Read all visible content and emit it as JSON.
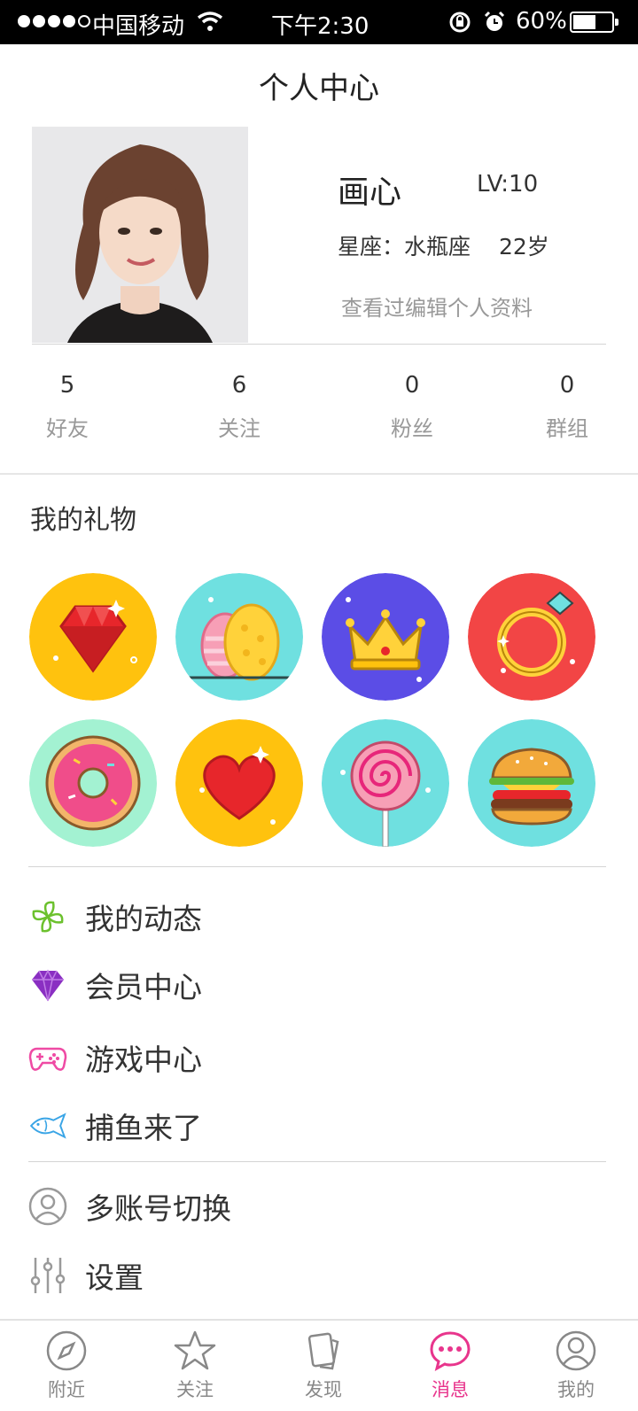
{
  "status_bar": {
    "carrier": "中国移动",
    "time": "下午2:30",
    "battery_text": "60%",
    "battery_level": 0.6,
    "signal_bars": 4,
    "signal_max": 5
  },
  "header": {
    "title": "个人中心"
  },
  "profile": {
    "nickname": "画心",
    "level": "LV:10",
    "zodiac": "星座：水瓶座",
    "age": "22岁",
    "edit_link": "查看过编辑个人资料"
  },
  "stats": [
    {
      "value": "5",
      "label": "好友"
    },
    {
      "value": "6",
      "label": "关注"
    },
    {
      "value": "0",
      "label": "粉丝"
    },
    {
      "value": "0",
      "label": "群组"
    }
  ],
  "gifts": {
    "title": "我的礼物",
    "items": [
      {
        "icon": "ruby-gem-icon",
        "bg": "#ffc20e"
      },
      {
        "icon": "easter-eggs-icon",
        "bg": "#6fe0e0"
      },
      {
        "icon": "crown-icon",
        "bg": "#5b4de6"
      },
      {
        "icon": "diamond-ring-icon",
        "bg": "#f24545"
      },
      {
        "icon": "donut-icon",
        "bg": "#a3f2d2"
      },
      {
        "icon": "heart-icon",
        "bg": "#ffc20e"
      },
      {
        "icon": "lollipop-icon",
        "bg": "#6fe0e0"
      },
      {
        "icon": "burger-icon",
        "bg": "#6fe0e0"
      }
    ]
  },
  "menu": [
    {
      "label": "我的动态",
      "icon": "pinwheel-icon",
      "color": "#6cc12e"
    },
    {
      "label": "会员中心",
      "icon": "diamond-icon",
      "color": "#8a2fc2"
    },
    {
      "label": "游戏中心",
      "icon": "gamepad-icon",
      "color": "#ef4aa4"
    },
    {
      "label": "捕鱼来了",
      "icon": "fish-icon",
      "color": "#3aa5e6"
    },
    {
      "label": "多账号切换",
      "icon": "user-switch-icon",
      "color": "#9a9a9a"
    },
    {
      "label": "设置",
      "icon": "settings-sliders-icon",
      "color": "#9a9a9a"
    }
  ],
  "tabbar": {
    "active_color": "#e8358c",
    "items": [
      {
        "label": "附近",
        "icon": "compass-icon"
      },
      {
        "label": "关注",
        "icon": "star-icon"
      },
      {
        "label": "发现",
        "icon": "cards-icon"
      },
      {
        "label": "消息",
        "icon": "message-icon",
        "active": true
      },
      {
        "label": "我的",
        "icon": "profile-icon"
      }
    ]
  }
}
